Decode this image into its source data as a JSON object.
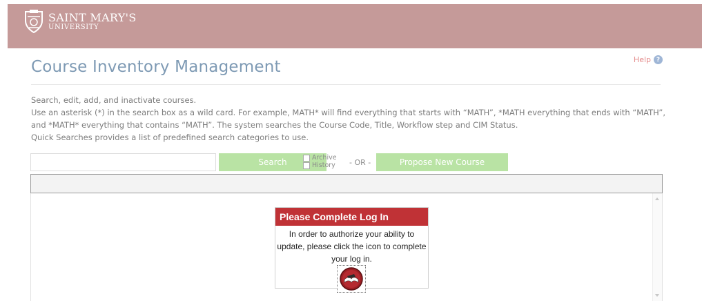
{
  "header": {
    "logo_line1": "SAINT MARY'S",
    "logo_line2": "UNIVERSITY",
    "bg_color": "#c59a99"
  },
  "help": {
    "label": "Help",
    "icon": "question-icon"
  },
  "page": {
    "title": "Course Inventory Management",
    "description": [
      "Search, edit, add, and inactivate courses.",
      "Use an asterisk (*) in the search box as a wild card. For example, MATH* will find everything that starts with “MATH”, *MATH everything that ends with “MATH”, and *MATH* everything that contains “MATH”. The system searches the Course Code, Title, Workflow step and CIM Status.",
      "Quick Searches provides a list of predefined search categories to use."
    ]
  },
  "search": {
    "value": "",
    "placeholder": "",
    "button_label": "Search",
    "archive_label": "Archive",
    "history_label": "History",
    "or_label": "- OR -",
    "propose_label": "Propose New Course",
    "button_color": "#b9e3a4"
  },
  "login": {
    "title": "Please Complete Log In",
    "message": "In order to authorize your ability to update, please click the icon to complete your log in.",
    "title_color": "#c03236",
    "icon": "login-book-icon"
  }
}
